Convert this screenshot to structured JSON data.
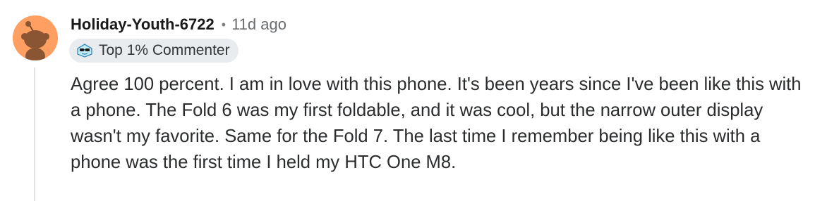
{
  "comment": {
    "username": "Holiday-Youth-6722",
    "separator": "•",
    "timestamp": "11d ago",
    "badge": {
      "icon": "top-commenter-icon",
      "label": "Top 1% Commenter"
    },
    "body": "Agree 100 percent. I am in love with this phone. It's been years since I've been like this with a phone. The Fold 6 was my first foldable, and it was cool, but the narrow outer display wasn't my favorite. Same for the Fold 7. The last time I remember being like this with a phone was the first time I held my HTC One M8."
  },
  "colors": {
    "avatar_bg": "#ff9f62",
    "badge_bg": "#e9ecee",
    "thread_line": "#e0e3e5"
  }
}
